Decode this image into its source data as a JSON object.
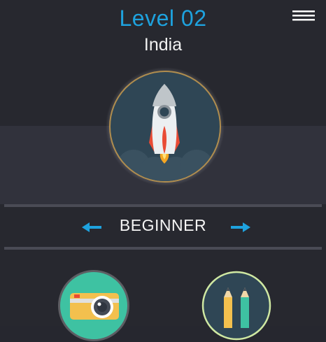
{
  "header": {
    "level_title": "Level 02",
    "country": "India"
  },
  "menu": {
    "icon": "hamburger-menu-icon"
  },
  "badge": {
    "icon": "rocket-icon",
    "ring_color": "#b08d4e",
    "background_color": "#2f4655"
  },
  "difficulty": {
    "label": "BEGINNER",
    "prev_icon": "arrow-left-icon",
    "next_icon": "arrow-right-icon"
  },
  "categories": [
    {
      "icon": "camera-icon",
      "background_color": "#3ec2a2"
    },
    {
      "icon": "pencils-icon",
      "background_color": "#2f4655",
      "ring_color": "#cfe8a2"
    }
  ],
  "colors": {
    "accent": "#1ea2de",
    "background": "#27282f"
  }
}
